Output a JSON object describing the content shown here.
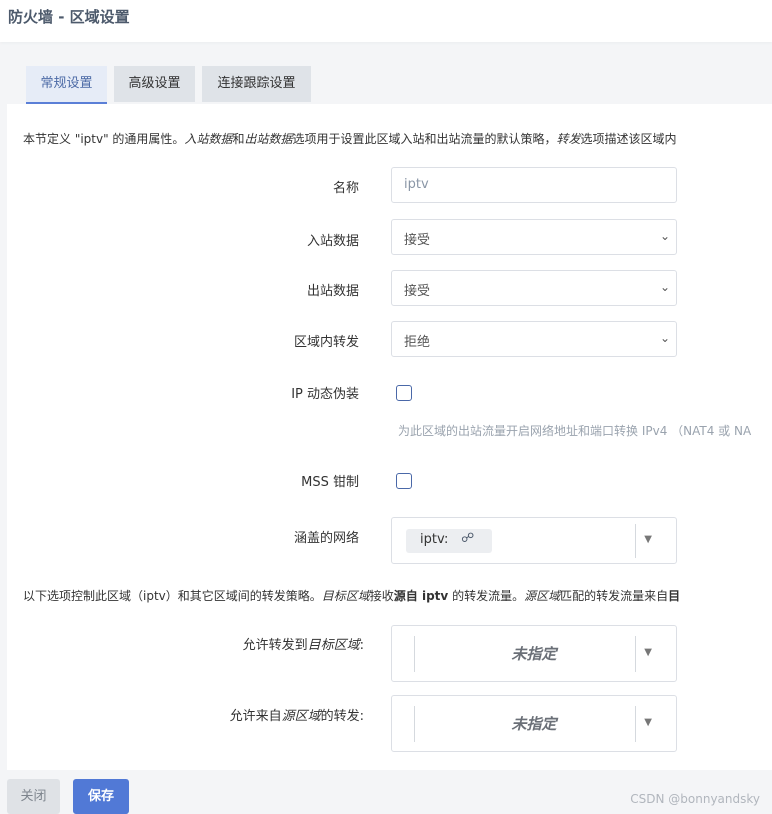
{
  "page": {
    "title": "防火墙 - 区域设置"
  },
  "tabs": [
    {
      "label": "常规设置",
      "active": true
    },
    {
      "label": "高级设置",
      "active": false
    },
    {
      "label": "连接跟踪设置",
      "active": false
    }
  ],
  "intro": {
    "prefix": "本节定义 \"iptv\" 的通用属性。",
    "in_italic": "入站数据",
    "and": "和",
    "out_italic": "出站数据",
    "middle": "选项用于设置此区域入站和出站流量的默认策略，",
    "fwd_italic": "转发",
    "suffix": "选项描述该区域内"
  },
  "form": {
    "name": {
      "label": "名称",
      "value": "iptv"
    },
    "input": {
      "label": "入站数据",
      "value": "接受"
    },
    "output": {
      "label": "出站数据",
      "value": "接受"
    },
    "forward": {
      "label": "区域内转发",
      "value": "拒绝"
    },
    "masq": {
      "label": "IP 动态伪装",
      "checked": false,
      "hint": "为此区域的出站流量开启网络地址和端口转换 IPv4 （NAT4 或 NA"
    },
    "mss": {
      "label": "MSS 钳制",
      "checked": false
    },
    "networks": {
      "label": "涵盖的网络",
      "chip": "iptv:",
      "chip_icon": "network-icon"
    }
  },
  "forward_section": {
    "p1": "以下选项控制此区域（iptv）和其它区域间的转发策略。",
    "p2_italic": "目标区域",
    "p3": "接收",
    "p4_bold": "源自 iptv",
    "p5": " 的转发流量。",
    "p6_italic": "源区域",
    "p7": "匹配的转发流量来自",
    "p8_bold": "目"
  },
  "dest": {
    "label_pre": "允许转发到",
    "label_italic": "目标区域",
    "label_post": ":",
    "value": "未指定"
  },
  "src": {
    "label_pre": "允许来自",
    "label_italic": "源区域",
    "label_post": "的转发:",
    "value": "未指定"
  },
  "buttons": {
    "close": "关闭",
    "save": "保存"
  },
  "watermark": "CSDN @bonnyandsky",
  "colors": {
    "accent": "#5179d6",
    "tab_active_text": "#4c6aa6"
  }
}
